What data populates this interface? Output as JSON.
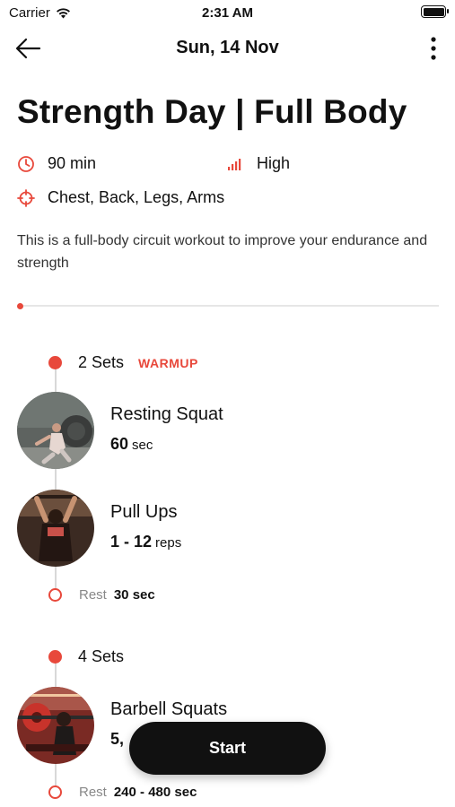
{
  "status_bar": {
    "carrier": "Carrier",
    "time": "2:31 AM"
  },
  "nav": {
    "title": "Sun, 14 Nov"
  },
  "workout": {
    "title": "Strength Day | Full Body",
    "duration": "90 min",
    "intensity": "High",
    "muscles": "Chest, Back, Legs, Arms",
    "description": "This is a full-body circuit workout to improve your endurance and strength"
  },
  "progress_fraction": 0.0,
  "sets": [
    {
      "label": "2 Sets",
      "tag": "WARMUP",
      "exercises": [
        {
          "name": "Resting Squat",
          "amount": "60",
          "unit": "sec"
        },
        {
          "name": "Pull Ups",
          "amount": "1 - 12",
          "unit": "reps"
        }
      ],
      "rest": {
        "label": "Rest",
        "value": "30 sec"
      }
    },
    {
      "label": "4 Sets",
      "tag": "",
      "exercises": [
        {
          "name": "Barbell Squats",
          "amount": "5,",
          "unit": ""
        }
      ],
      "rest": {
        "label": "Rest",
        "value": "240 - 480 sec"
      }
    }
  ],
  "start_label": "Start",
  "colors": {
    "accent": "#e8483b",
    "button": "#111111"
  }
}
